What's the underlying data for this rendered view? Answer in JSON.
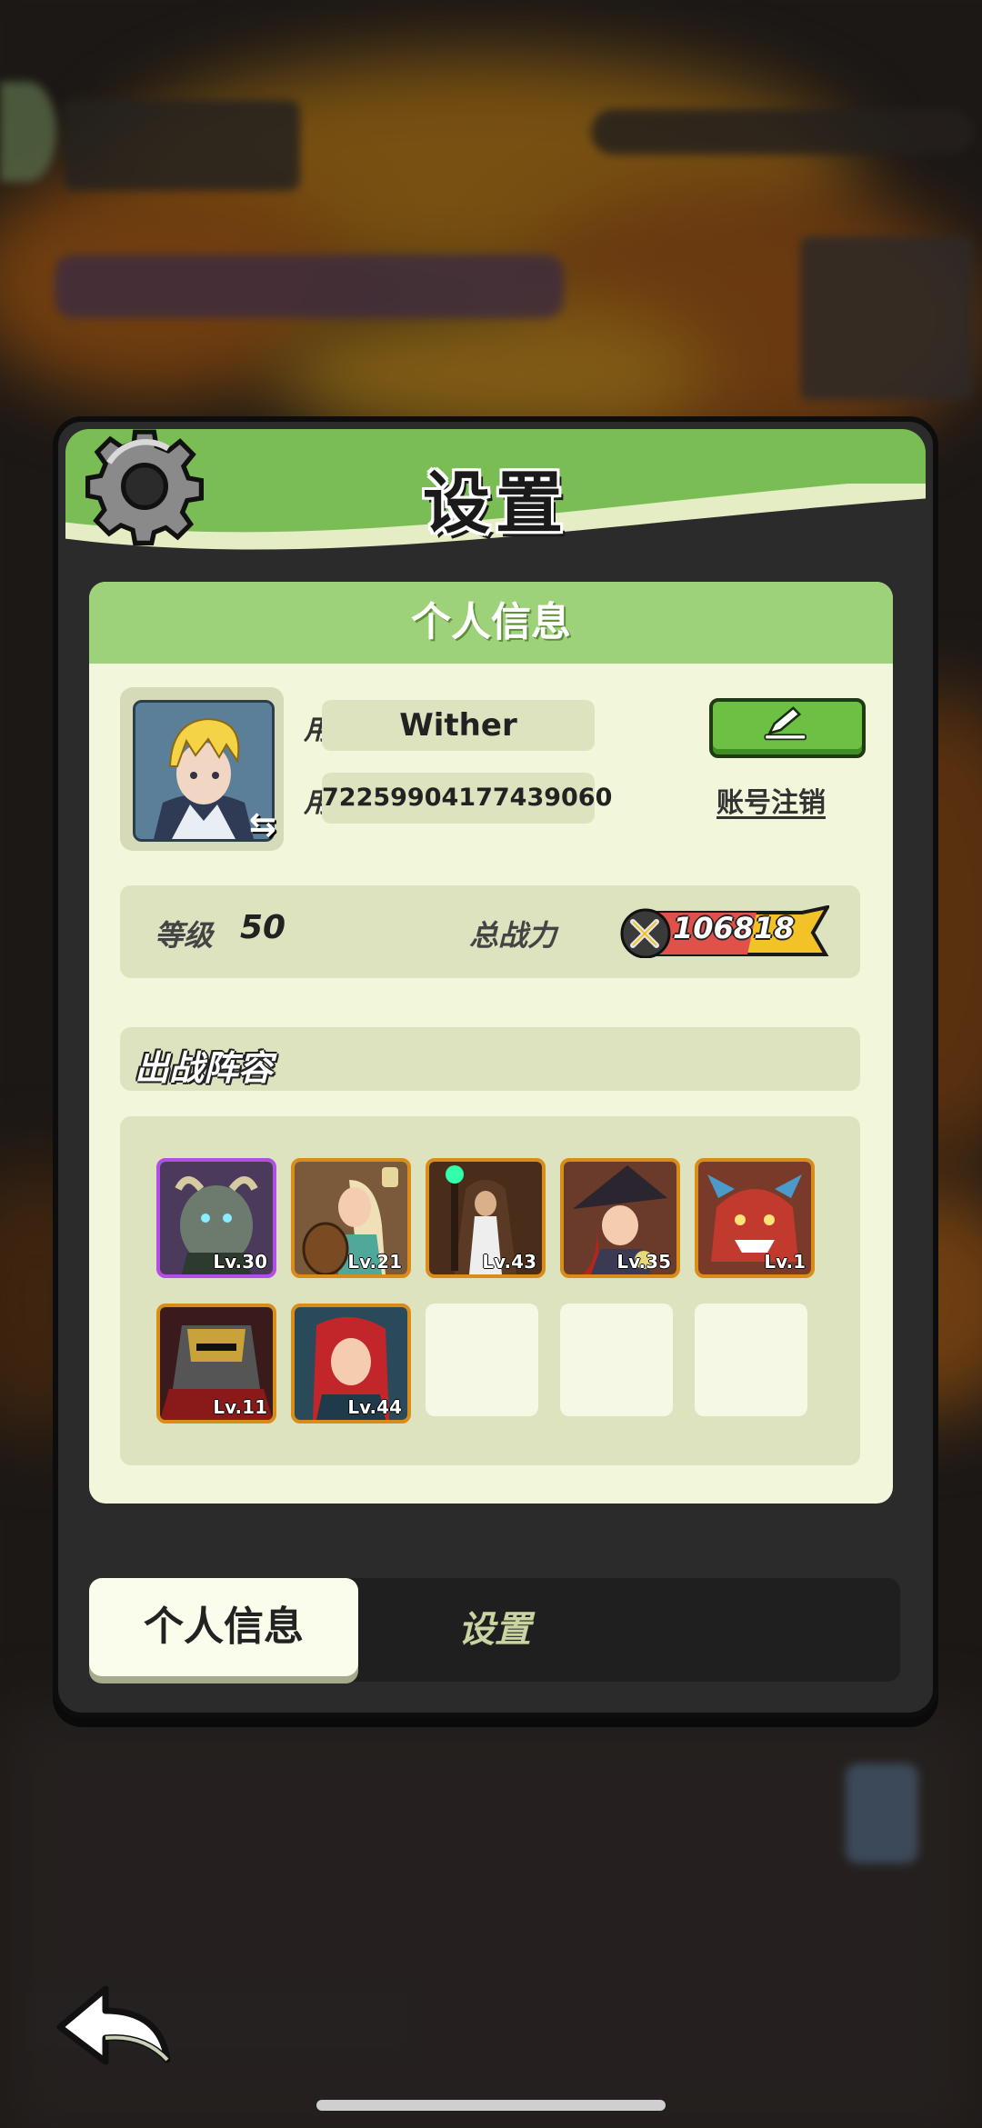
{
  "modal": {
    "title": "设置",
    "panel_title": "个人信息"
  },
  "profile": {
    "nickname_label": "用户昵称",
    "nickname": "Wither",
    "id_label": "用户  ID",
    "user_id": "72259904177439060",
    "cancel_account": "账号注销"
  },
  "stats": {
    "level_label": "等级",
    "level": "50",
    "power_label": "总战力",
    "power": "106818"
  },
  "lineup": {
    "title": "出战阵容",
    "heroes": [
      {
        "level": "Lv.30",
        "rarity": "epic"
      },
      {
        "level": "Lv.21",
        "rarity": "legendary"
      },
      {
        "level": "Lv.43",
        "rarity": "legendary"
      },
      {
        "level": "Lv.35",
        "rarity": "legendary"
      },
      {
        "level": "Lv.1",
        "rarity": "legendary"
      },
      {
        "level": "Lv.11",
        "rarity": "legendary"
      },
      {
        "level": "Lv.44",
        "rarity": "legendary"
      }
    ],
    "empty_slots": 3
  },
  "tabs": {
    "active": "个人信息",
    "inactive": "设置"
  },
  "colors": {
    "header_green": "#7bbd55",
    "panel_bg": "#f2f7dc",
    "epic_border": "#b04ee6",
    "legendary_border": "#d98c17"
  },
  "icons": [
    "gear-icon",
    "edit-pencil-icon",
    "swap-icon",
    "crossed-swords-icon",
    "back-arrow-icon"
  ]
}
